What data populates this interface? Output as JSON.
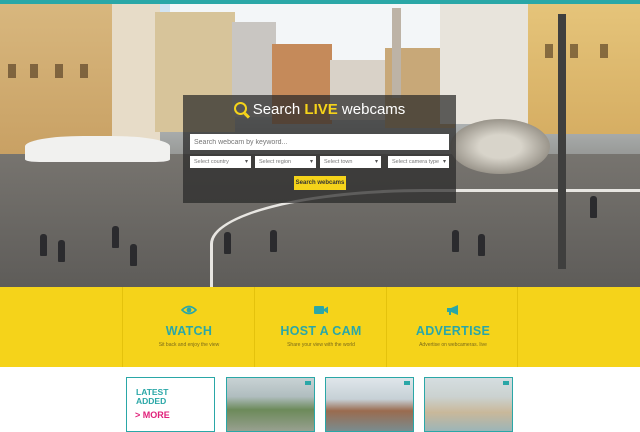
{
  "hero": {
    "search_prefix": "Search",
    "search_highlight": "LIVE",
    "search_suffix": "webcams",
    "keyword_placeholder": "Search webcam by keyword...",
    "select_country": "Select country",
    "select_region": "Select region",
    "select_town": "Select town",
    "select_camera_type": "Select camera type",
    "search_button": "Search webcams"
  },
  "features": [
    {
      "title": "WATCH",
      "subtitle": "Sit back and enjoy the view",
      "icon": "eye-icon"
    },
    {
      "title": "HOST A CAM",
      "subtitle": "Share your view with the world",
      "icon": "video-camera-icon"
    },
    {
      "title": "ADVERTISE",
      "subtitle": "Advertise on webcameras. live",
      "icon": "megaphone-icon"
    }
  ],
  "latest": {
    "line1": "LATEST",
    "line2": "ADDED",
    "more": "> MORE"
  },
  "colors": {
    "accent_teal": "#2aa7a7",
    "accent_yellow": "#f5d31a",
    "more_pink": "#e0217a"
  }
}
